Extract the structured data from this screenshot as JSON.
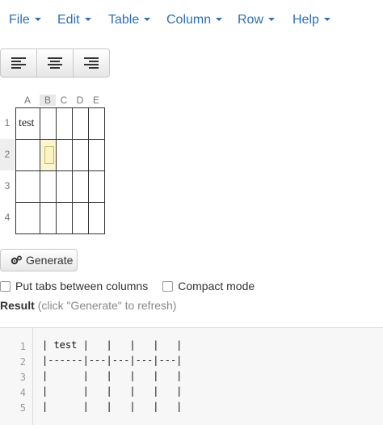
{
  "menu": {
    "items": [
      {
        "label": "File"
      },
      {
        "label": "Edit"
      },
      {
        "label": "Table"
      },
      {
        "label": "Column"
      },
      {
        "label": "Row"
      },
      {
        "label": "Help"
      }
    ]
  },
  "toolbar": {
    "align_buttons": [
      "align-left",
      "align-center",
      "align-right"
    ]
  },
  "grid": {
    "columns": [
      "A",
      "B",
      "C",
      "D",
      "E"
    ],
    "rows": [
      "1",
      "2",
      "3",
      "4"
    ],
    "active_column": "B",
    "active_row": "2",
    "cells": [
      [
        "test",
        "",
        "",
        "",
        ""
      ],
      [
        "",
        "",
        "",
        "",
        ""
      ],
      [
        "",
        "",
        "",
        "",
        ""
      ],
      [
        "",
        "",
        "",
        "",
        ""
      ]
    ]
  },
  "actions": {
    "generate_label": "Generate",
    "generate_icon": "gears-icon"
  },
  "options": {
    "tabs_label": "Put tabs between columns",
    "compact_label": "Compact mode",
    "tabs_checked": false,
    "compact_checked": false
  },
  "result": {
    "heading": "Result",
    "hint": "(click \"Generate\" to refresh)"
  },
  "output": {
    "line_numbers": [
      "1",
      "2",
      "3",
      "4",
      "5"
    ],
    "lines": [
      "| test |   |   |   |   |",
      "|------|---|---|---|---|",
      "|      |   |   |   |   |",
      "|      |   |   |   |   |",
      "|      |   |   |   |   |"
    ]
  }
}
